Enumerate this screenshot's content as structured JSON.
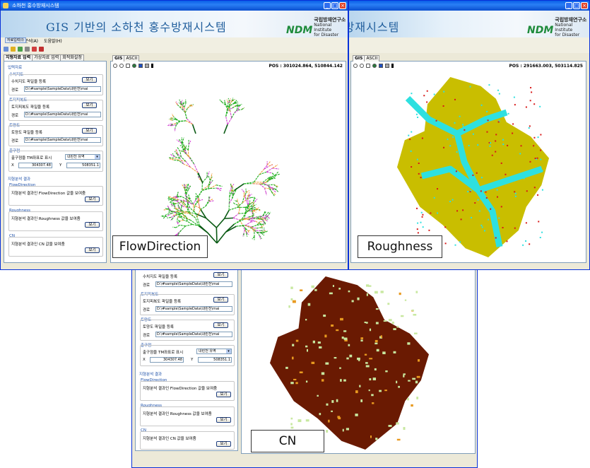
{
  "window1": {
    "title": "소하천 홍수방재시스템",
    "banner_title": "GIS 기반의 소하천 홍수방재시스템",
    "logo_mark": "NDM",
    "logo_name": "국립방재연구소",
    "logo_sub1": "National Institute",
    "logo_sub2": "for Disaster Prevention",
    "menu": [
      "파일(F)",
      "자료입력(I)",
      "분석(A)",
      "도움말(H)"
    ],
    "left_tabs": [
      "지형자료 입력",
      "가상자료 입력",
      "회적화설정"
    ],
    "input_group": "입력자료",
    "stream_group": "수치지도",
    "stream_label": "수치지도 파일을 등록",
    "soil_group": "토지피복도",
    "soil_label": "토지피복도 파일을 등록",
    "landuse_group": "토양도",
    "landuse_label": "토양도 파일을 등록",
    "path_label": "경로",
    "path_value": "D:\\#sample\\SampleData\\내린천\\mai",
    "view_button": "보기",
    "outlet_group": "출구점",
    "outlet_label": "출구점을 TM좌표로 표시",
    "outlet_select": "내린천 유역",
    "x_label": "X",
    "x_value": "304307.48",
    "y_label": "Y",
    "y_value": "508351.1",
    "result_group": "지형분석 결과",
    "flow_group": "FlowDirection",
    "flow_label": "지형분석 결과인 FlowDirection 값을 보여줌",
    "rough_group": "Roughness",
    "rough_label": "지형분석 결과인 Roughness 값을 보여줌",
    "cn_group": "CN",
    "cn_label": "지형분석 결과인  CN 값을 보여줌",
    "gis_tabs": [
      "GIS",
      "ASCII"
    ],
    "pos": "POS : 301024.864,  510844.142",
    "caption": "FlowDirection"
  },
  "window2": {
    "banner_title": "소하천 홍수방재시스템",
    "pos": "POS : 291663.003,  503114.825",
    "caption": "Roughness"
  },
  "window3": {
    "caption": "CN"
  },
  "colors": {
    "flow_green": "#22b022",
    "flow_orange": "#f0a040",
    "flow_magenta": "#d040d0",
    "flow_dark": "#0a5a14",
    "rough_olive": "#c9be00",
    "rough_cyan": "#2ee0e0",
    "rough_red": "#d81818",
    "cn_brown": "#6a1a02",
    "cn_light": "#c8e8a0",
    "cn_orange": "#e89a20"
  }
}
